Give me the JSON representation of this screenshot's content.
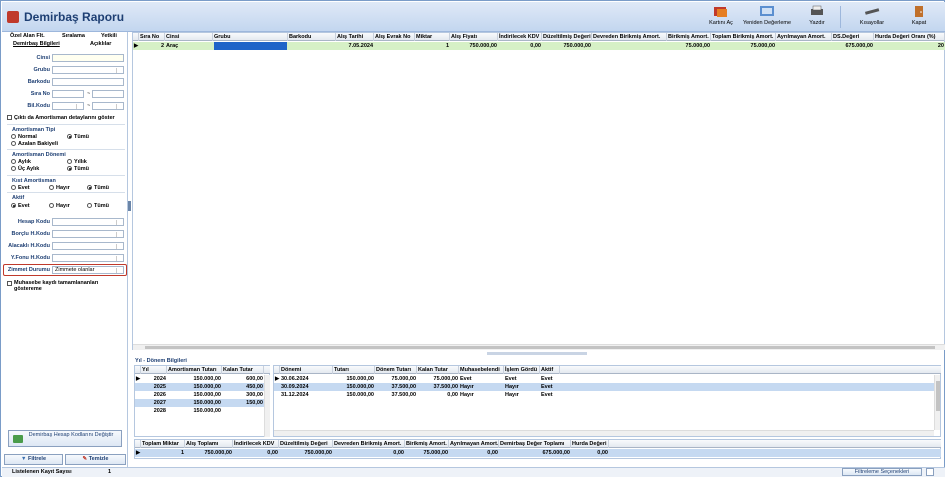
{
  "window": {
    "title": "Demirbaş Raporu"
  },
  "toolbar": [
    {
      "label": "Kartını Aç",
      "icon": "card-open-icon"
    },
    {
      "label": "Yeniden Değerleme",
      "icon": "revalue-icon"
    },
    {
      "label": "Yazdır",
      "icon": "printer-icon"
    },
    {
      "label": "Kısayollar",
      "icon": "shortcut-icon"
    },
    {
      "label": "Kapat",
      "icon": "door-exit-icon"
    }
  ],
  "left": {
    "tabs_top": [
      "Özel Alan Flt.",
      "Sıralama",
      "Yetkili"
    ],
    "tabs_bottom": [
      "Demirbaş Bilgileri",
      "Açıklılar"
    ],
    "fields": [
      {
        "label": "Cinsi",
        "value": ""
      },
      {
        "label": "Grubu",
        "value": ""
      },
      {
        "label": "Barkodu",
        "value": ""
      },
      {
        "label": "Sıra No",
        "value": ""
      },
      {
        "label": "Bil.Kodu",
        "value": ""
      }
    ],
    "range_sep": "~",
    "show_sold": "Çıktı da Amortisman detaylarını göster",
    "amort_type": {
      "title": "Amortisman Tipi",
      "options": [
        "Normal",
        "Tümü",
        "Azalan Bakiyeli"
      ]
    },
    "amort_period": {
      "title": "Amortisman Dönemi",
      "options": [
        "Aylık",
        "Yıllık",
        "Üç Aylık",
        "Tümü"
      ]
    },
    "partial": {
      "title": "Kıst Amortisman",
      "options": [
        "Evet",
        "Hayır",
        "Tümü"
      ]
    },
    "active": {
      "title": "Aktif",
      "options": [
        "Evet",
        "Hayır",
        "Tümü"
      ]
    },
    "accounts": [
      {
        "label": "Hesap Kodu",
        "value": ""
      },
      {
        "label": "Borçlu H.Kodu",
        "value": ""
      },
      {
        "label": "Alacaklı H.Kodu",
        "value": ""
      },
      {
        "label": "Y.Fonu H.Kodu",
        "value": ""
      }
    ],
    "zimmet": {
      "label": "Zimmet Durumu",
      "value": "Zimmete olanlar"
    },
    "muhasebe": "Muhasebe kaydı tamamlananları göstereme",
    "change_button": "Demirbaş Hesap Kodlarını Değiştir",
    "filter_button": "Filtrele",
    "clear_button": "Temizle"
  },
  "status": {
    "left_label": "Listelenen Kayıt Sayısı",
    "count": "1",
    "right_button": "Filtreleme Seçenekleri"
  },
  "main_grid": {
    "columns": [
      "Sıra No",
      "Cinsi",
      "Grubu",
      "Barkodu",
      "Alış Tarihi",
      "Alış Evrak No",
      "Miktar",
      "Alış Fiyatı",
      "İndirilecek KDV",
      "Düzeltilmiş Değeri",
      "Devreden Birikmiş Amort.",
      "Birikmiş Amort.",
      "Toplam Birikmiş Amort.",
      "Ayrılmayan Amort.",
      "DS.Değeri",
      "Hurda Değeri Oranı (%)"
    ],
    "row": [
      "2",
      "Araç",
      "",
      "",
      "7.05.2024",
      "",
      "1",
      "750.000,00",
      "0,00",
      "750.000,00",
      "",
      "75.000,00",
      "75.000,00",
      "",
      "675.000,00",
      "20"
    ]
  },
  "year_section": {
    "title": "Yıl - Dönem Bilgileri"
  },
  "years": {
    "columns": [
      "Yıl",
      "Amortisman Tutarı",
      "Kalan Tutar"
    ],
    "rows": [
      [
        "2024",
        "150.000,00",
        "600,00"
      ],
      [
        "2025",
        "150.000,00",
        "450,00"
      ],
      [
        "2026",
        "150.000,00",
        "300,00"
      ],
      [
        "2027",
        "150.000,00",
        "150,00"
      ],
      [
        "2028",
        "150.000,00",
        ""
      ]
    ]
  },
  "periods": {
    "columns": [
      "Dönemi",
      "Tutarı",
      "Dönem Tutarı",
      "Kalan Tutar",
      "Muhasebelendi",
      "İşlem Gördü",
      "Aktif"
    ],
    "rows": [
      [
        "30.06.2024",
        "150.000,00",
        "75.000,00",
        "75.000,00",
        "Evet",
        "Evet",
        "Evet"
      ],
      [
        "30.09.2024",
        "150.000,00",
        "37.500,00",
        "37.500,00",
        "Hayır",
        "Hayır",
        "Evet"
      ],
      [
        "31.12.2024",
        "150.000,00",
        "37.500,00",
        "0,00",
        "Hayır",
        "Hayır",
        "Evet"
      ]
    ]
  },
  "totals": {
    "columns": [
      "Toplam Miktar",
      "Alış Toplamı",
      "İndirilecek KDV",
      "Düzeltilmiş Değeri",
      "Devreden Birikmiş Amort.",
      "Birikmiş Amort.",
      "Ayrılmayan Amort.",
      "Demirbaş Değer Toplamı",
      "Hurda Değeri"
    ],
    "row": [
      "1",
      "750.000,00",
      "0,00",
      "750.000,00",
      "0,00",
      "75.000,00",
      "0,00",
      "675.000,00",
      "0,00"
    ]
  }
}
